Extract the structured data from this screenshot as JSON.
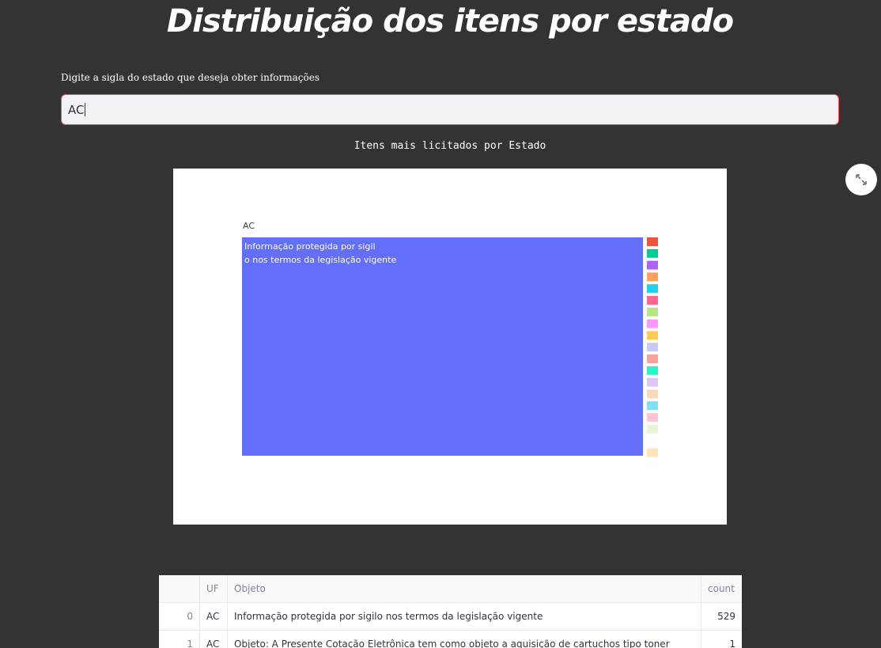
{
  "page": {
    "title": "Distribuição dos itens por estado"
  },
  "state_input": {
    "label": "Digite a sigla do estado que deseja obter informações",
    "value": "AC"
  },
  "chart_heading": "Itens mais licitados por Estado",
  "chart_data": {
    "type": "treemap",
    "root_label": "AC",
    "main_label_lines": [
      "Informação protegida por sigil",
      "o nos termos da legislação vigente"
    ],
    "colors": {
      "main": "#636efa",
      "small_tiles": [
        "#ef553b",
        "#00cc96",
        "#ab63fa",
        "#ffa15a",
        "#19d3f3",
        "#ff6692",
        "#b6e880",
        "#ff97ff",
        "#fecb52",
        "#c6cbf4",
        "#f7a398",
        "#27f5c3",
        "#dcc6f7",
        "#fed6b8",
        "#79e2f6",
        "#fdc6d3",
        "#e6f6d6",
        "#fde5b3"
      ]
    },
    "nodes": [
      {
        "label": "Informação protegida por sigilo nos termos da legislação vigente",
        "value": 529
      }
    ]
  },
  "table": {
    "columns": [
      "",
      "UF",
      "Objeto",
      "count"
    ],
    "rows": [
      {
        "index": "0",
        "uf": "AC",
        "objeto": "Informação protegida por sigilo nos termos da legislação vigente",
        "count": "529"
      },
      {
        "index": "1",
        "uf": "AC",
        "objeto": "Objeto: A Presente Cotação Eletrônica tem como objeto a aquisição de cartuchos tipo toner",
        "count": "1"
      }
    ]
  },
  "icons": {
    "fullscreen": "expand-arrows-icon"
  }
}
